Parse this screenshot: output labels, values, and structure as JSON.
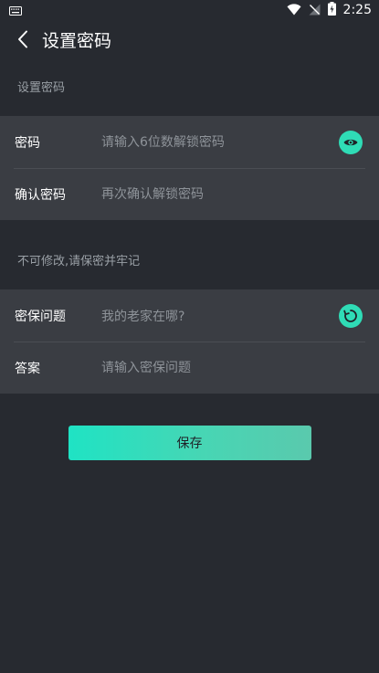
{
  "status_bar": {
    "time": "2:25",
    "icons": [
      "keyboard-icon",
      "wifi-icon",
      "no-signal-icon",
      "battery-charging-icon"
    ]
  },
  "header": {
    "title": "设置密码",
    "back_icon": "chevron-left-icon"
  },
  "section1": {
    "label": "设置密码",
    "rows": [
      {
        "label": "密码",
        "placeholder": "请输入6位数解锁密码",
        "action_icon": "eye-icon"
      },
      {
        "label": "确认密码",
        "placeholder": "再次确认解锁密码"
      }
    ]
  },
  "section2": {
    "label": "不可修改,请保密并牢记",
    "rows": [
      {
        "label": "密保问题",
        "value": "我的老家在哪?",
        "action_icon": "refresh-icon"
      },
      {
        "label": "答案",
        "placeholder": "请输入密保问题"
      }
    ]
  },
  "save_button": {
    "label": "保存"
  },
  "colors": {
    "background": "#272a30",
    "card": "#3a3d43",
    "accent": "#2fdcb6",
    "muted_text": "#8e9399"
  }
}
